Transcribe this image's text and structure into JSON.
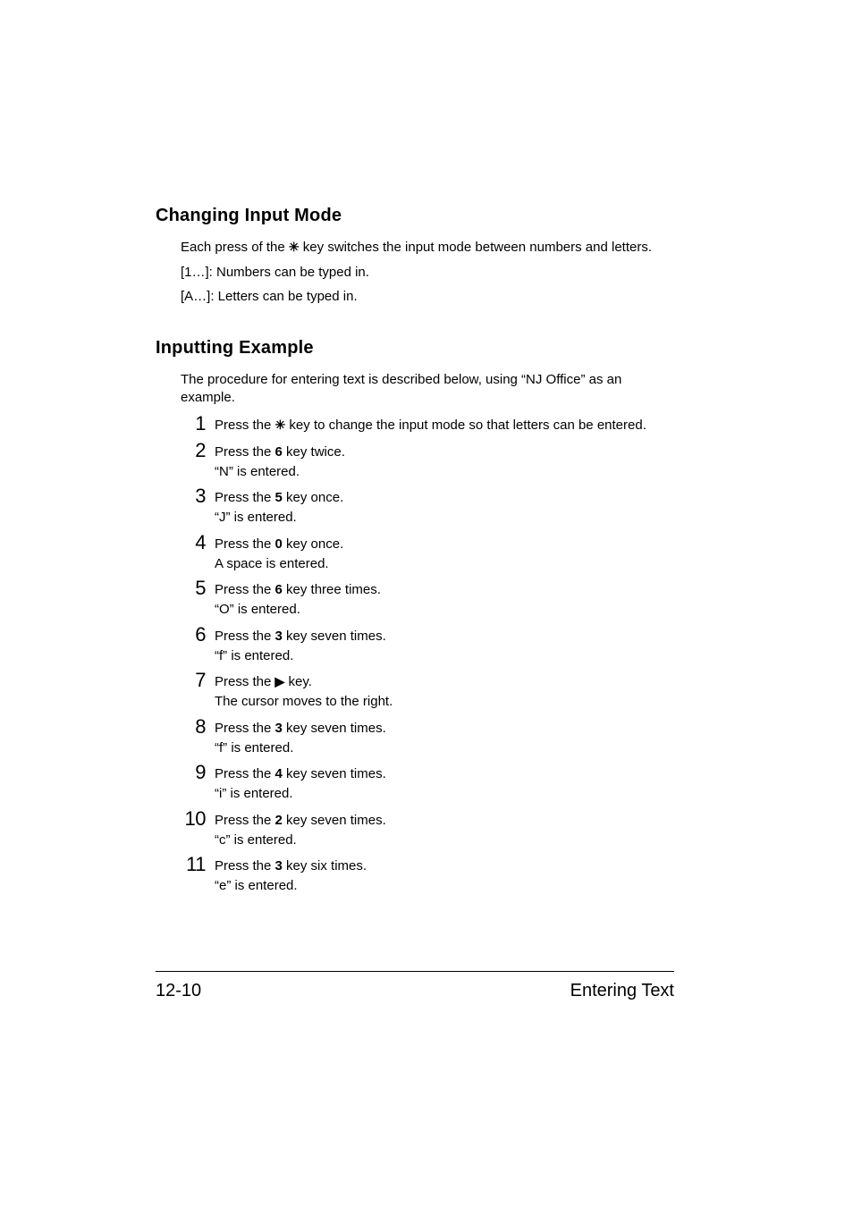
{
  "sections": {
    "changing_input": {
      "title": "Changing Input Mode",
      "para_prefix": "Each press of the ",
      "star_glyph": "✳",
      "para_suffix": " key switches the input mode between numbers and letters.",
      "note1": "[1…]: Numbers can be typed in.",
      "note2": "[A…]: Letters can be typed in."
    },
    "inputting_example": {
      "title": "Inputting Example",
      "intro": "The procedure for entering text is described below, using “NJ Office” as an example.",
      "steps": [
        {
          "num": "1",
          "pre": "Press the ",
          "glyph": "✳",
          "mid": "",
          "post": " key to change the input mode so that letters can be entered.",
          "line2": ""
        },
        {
          "num": "2",
          "pre": "Press the ",
          "glyph": "",
          "mid": "6",
          "post": " key twice.",
          "line2": "“N” is entered."
        },
        {
          "num": "3",
          "pre": "Press the ",
          "glyph": "",
          "mid": "5",
          "post": " key once.",
          "line2": "“J” is entered."
        },
        {
          "num": "4",
          "pre": "Press the ",
          "glyph": "",
          "mid": "0",
          "post": " key once.",
          "line2": "A space is entered."
        },
        {
          "num": "5",
          "pre": "Press the ",
          "glyph": "",
          "mid": "6",
          "post": " key three times.",
          "line2": "“O” is entered."
        },
        {
          "num": "6",
          "pre": "Press the ",
          "glyph": "",
          "mid": "3",
          "post": " key seven times.",
          "line2": "“f” is entered."
        },
        {
          "num": "7",
          "pre": "Press the ",
          "glyph": "▶",
          "mid": "",
          "post": " key.",
          "line2": "The cursor moves to the right."
        },
        {
          "num": "8",
          "pre": "Press the ",
          "glyph": "",
          "mid": "3",
          "post": " key seven times.",
          "line2": "“f” is entered."
        },
        {
          "num": "9",
          "pre": "Press the ",
          "glyph": "",
          "mid": "4",
          "post": " key seven times.",
          "line2": "“i” is entered."
        },
        {
          "num": "10",
          "pre": "Press the ",
          "glyph": "",
          "mid": "2",
          "post": " key seven times.",
          "line2": "“c” is entered."
        },
        {
          "num": "11",
          "pre": "Press the ",
          "glyph": "",
          "mid": "3",
          "post": " key six times.",
          "line2": "“e” is entered."
        }
      ]
    }
  },
  "footer": {
    "page_num": "12-10",
    "title": "Entering Text"
  }
}
